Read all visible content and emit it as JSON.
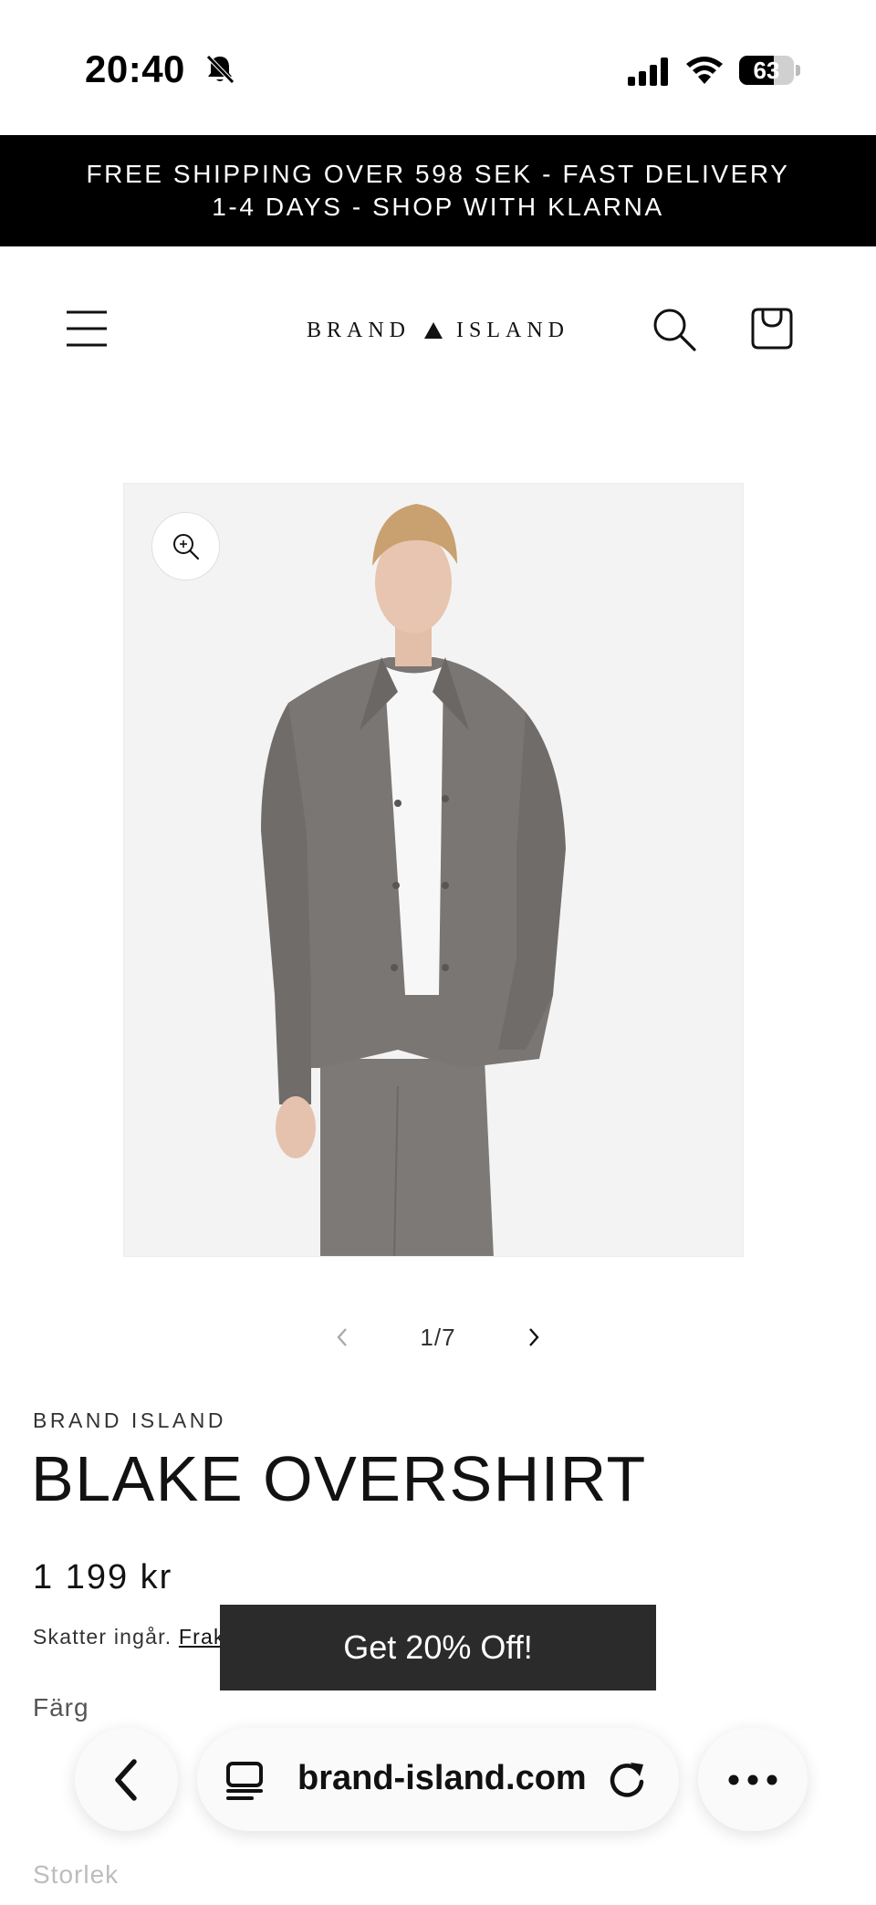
{
  "status_bar": {
    "time": "20:40",
    "battery_level": "63",
    "battery_fraction": 0.63,
    "icons": [
      "bell-slash-icon",
      "cellular-signal-icon",
      "wifi-icon",
      "battery-icon"
    ]
  },
  "announcement": {
    "text": "FREE SHIPPING OVER 598 SEK - FAST DELIVERY 1-4 DAYS - SHOP WITH KLARNA"
  },
  "header": {
    "logo_left": "BRAND",
    "logo_right": "ISLAND",
    "icons": [
      "hamburger-menu-icon",
      "logo-triangle-icon",
      "search-icon",
      "shopping-bag-icon"
    ]
  },
  "gallery": {
    "image_description_icon": "product-photo",
    "zoom_icon": "zoom-in-icon",
    "counter": "1/7"
  },
  "product": {
    "vendor": "BRAND ISLAND",
    "title": "BLAKE OVERSHIRT",
    "price": "1 199 kr",
    "tax_text": "Skatter ingår.",
    "tax_link": "Frak",
    "color_label": "Färg",
    "size_label": "Storlek"
  },
  "promo": {
    "label": "Get 20% Off!"
  },
  "browser": {
    "url": "brand-island.com",
    "icons": [
      "back-chevron-icon",
      "tabs-icon",
      "reload-icon",
      "more-icon"
    ]
  },
  "colors": {
    "announcement_bg": "#000000",
    "text": "#121212",
    "promo_bg": "#2b2b2b",
    "jacket": "#7a7674"
  }
}
